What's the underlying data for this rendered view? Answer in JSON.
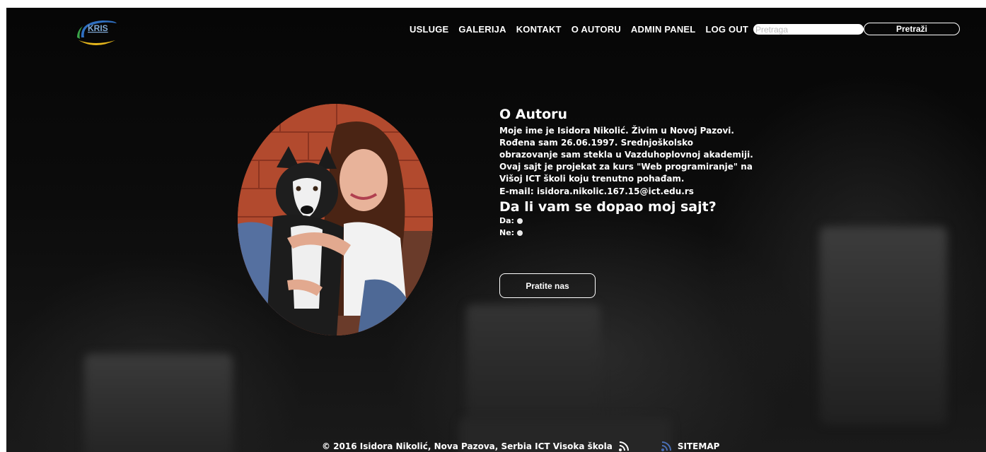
{
  "logo": {
    "text": "KRIS"
  },
  "nav": {
    "items": [
      "USLUGE",
      "GALERIJA",
      "KONTAKT",
      "O AUTORU",
      "ADMIN PANEL",
      "LOG OUT"
    ]
  },
  "search": {
    "placeholder": "Pretraga",
    "button_label": "Pretraži"
  },
  "about": {
    "title": "O Autoru",
    "bio": "Moje ime je Isidora Nikolić. Živim u Novoj Pazovi. Rođena sam 26.06.1997. Srednjoškolsko obrazovanje sam stekla u Vazduhoplovnoj akademiji. Ovaj sajt je projekat za kurs \"Web programiranje\" na Višoj ICT školi koju trenutno pohađam.",
    "email_label": "E-mail:",
    "email": "isidora.nikolic.167.15@ict.edu.rs"
  },
  "poll": {
    "question": "Da li vam se dopao moj sajt?",
    "options": [
      "Da:",
      "Ne:"
    ]
  },
  "follow_label": "Pratite nas",
  "footer": {
    "copyright": "© 2016 Isidora Nikolić, Nova Pazova, Serbia ICT Visoka škola",
    "sitemap_label": "SITEMAP"
  },
  "icons": [
    "rss-icon",
    "rss-icon"
  ]
}
